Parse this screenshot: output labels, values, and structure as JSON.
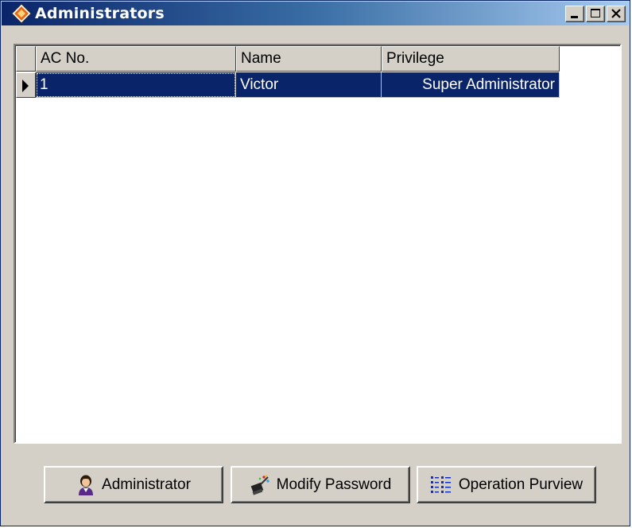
{
  "window": {
    "title": "Administrators",
    "controls": {
      "minimize": "minimize",
      "maximize": "maximize",
      "close": "close"
    },
    "accent": "#0a246a"
  },
  "grid": {
    "columns": [
      "AC No.",
      "Name",
      "Privilege"
    ],
    "rows": [
      {
        "ac_no": "1",
        "name": "Victor",
        "privilege": "Super Administrator",
        "selected": true
      }
    ]
  },
  "buttons": {
    "administrator": "Administrator",
    "modify_password": "Modify Password",
    "operation_purview": "Operation Purview"
  },
  "icons": {
    "app": "diamond-logo-icon",
    "administrator": "person-icon",
    "modify_password": "magic-wand-icon",
    "operation_purview": "list-tree-icon",
    "row_indicator": "triangle-right-icon"
  }
}
